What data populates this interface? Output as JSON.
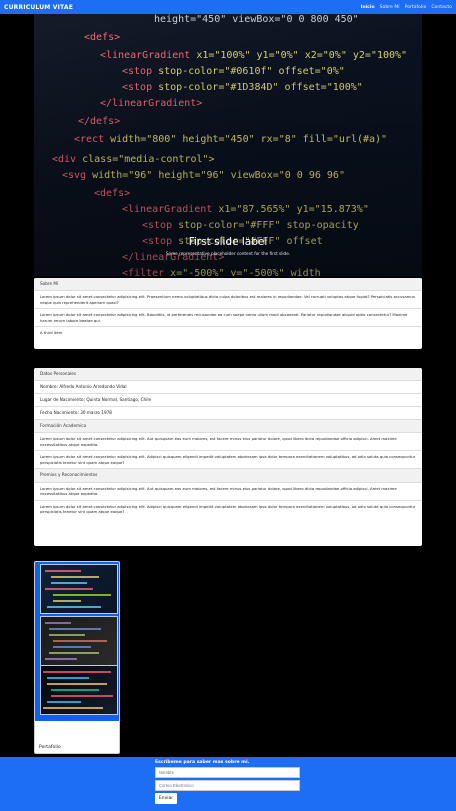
{
  "navbar": {
    "brand": "CURRICULUM VITAE",
    "links": [
      "Inicio",
      "Sobre Mí",
      "Portafolio",
      "Contacto"
    ]
  },
  "carousel": {
    "title": "First slide label",
    "subtitle": "Some representative placeholder content for the first slide."
  },
  "about": {
    "header": "Sobre Mí",
    "items": [
      "Lorem ipsum dolor sit amet consectetur adipisicing elit. Praesentium nemo voluptatibus dicta culpa doloribus est maiores in repudiandae. Vel corrupti voluptas atque fugiat? Perspiciatis accusamus neque quis reprehenderit aperiam quasi?",
      "Lorem ipsum dolor sit amet consectetur adipisicing elit. Blanditiis, id perferendis recusandae ea cum saepe nemo ullam modi obcaecati. Pariatur repudiandae aliquid optio consectetur? Maxime harum rerum labore beatae qui.",
      "A third item"
    ]
  },
  "datos": {
    "header": "Datos Personales",
    "fields": [
      "Nombre: Alfredo Antonio Arredondo Vidal",
      "Lugar de Nacimiento: Quinta Normal, Santiago, Chile",
      "Fecha Nacimiento: 30 marzo 1978"
    ],
    "formacion_header": "Formación Academica",
    "formacion": [
      "Lorem ipsum dolor sit amet consectetur adipisicing elit. Aut quisquam eos eum maiores, est facere minus eius pariatur dolore, quod libero dicta repudiandae officia adipisci. Amet maxime necessitatibus atque expedita.",
      "Lorem ipsum dolor sit amet consectetur adipisicing elit. Adipisci quisquam eligendi impedit voluptatem aboriosam ipsa dolor tempora exercitationem voluptatibus, ad odio soluta quia consequuntur perspiciatis tenetur sint quam atque eaque?"
    ],
    "premios_header": "Premios y Reconocimientos",
    "premios": [
      "Lorem ipsum dolor sit amet consectetur adipisicing elit. Aut quisquam eos eum maiores, est facere minus eius pariatur dolore, quod libero dicta repudiandae officia adipisci. Amet maxime necessitatibus atque expedita.",
      "Lorem ipsum dolor sit amet consectetur adipisicing elit. Adipisci quisquam eligendi impedit voluptatem aboriosam ipsa dolor tempora exercitationem voluptatibus, ad odio soluta quia consequuntur perspiciatis tenetur sint quam atque eaque?"
    ]
  },
  "portfolio": {
    "label": "Portafolio"
  },
  "footer": {
    "title": "Escribeme para saber mas sobre mi.",
    "name_placeholder": "Nombre",
    "email_placeholder": "Correo Electronico",
    "submit_label": "Enviar"
  },
  "colors": {
    "accent": "#1d6df5",
    "background": "#000000"
  }
}
